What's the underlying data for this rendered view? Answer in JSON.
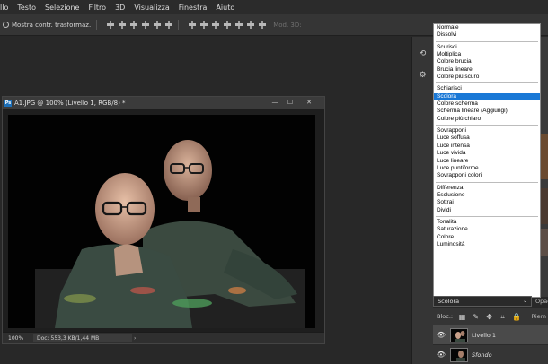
{
  "menu": [
    "llo",
    "Testo",
    "Selezione",
    "Filtro",
    "3D",
    "Visualizza",
    "Finestra",
    "Aiuto"
  ],
  "options_bar": {
    "show_transform_label": "Mostra contr. trasformaz.",
    "mode3d_label": "Mod. 3D:"
  },
  "document": {
    "title": "A1.JPG @ 100% (Livello 1, RGB/8) *",
    "zoom": "100%",
    "doc_info": "Doc: 553,3 KB/1,44 MB",
    "status_arrow": "›"
  },
  "window_controls": {
    "minimize": "—",
    "maximize": "☐",
    "close": "✕"
  },
  "blend_modes": {
    "groups": [
      [
        "Normale",
        "Dissolvi"
      ],
      [
        "Scurisci",
        "Moltiplica",
        "Colore brucia",
        "Brucia lineare",
        "Colore più scuro"
      ],
      [
        "Schiarisci",
        "Scolora",
        "Colore scherma",
        "Scherma lineare (Aggiungi)",
        "Colore più chiaro"
      ],
      [
        "Sovrapponi",
        "Luce soffusa",
        "Luce intensa",
        "Luce vivida",
        "Luce lineare",
        "Luce puntiforme",
        "Sovrapponi colori"
      ],
      [
        "Differenza",
        "Esclusione",
        "Sottrai",
        "Dividi"
      ],
      [
        "Tonalità",
        "Saturazione",
        "Colore",
        "Luminosità"
      ]
    ],
    "selected": "Scolora",
    "select_chevron": "⌄"
  },
  "layers_panel": {
    "opacity_label": "Opac",
    "lock_label": "Bloc.:",
    "fill_label": "Riem",
    "layers": [
      {
        "name": "Livello 1",
        "active": true,
        "italic": false
      },
      {
        "name": "Sfondo",
        "active": false,
        "italic": true
      }
    ]
  },
  "colors": {
    "accent": "#1a78d6",
    "panel": "#353535",
    "workspace": "#282828"
  }
}
